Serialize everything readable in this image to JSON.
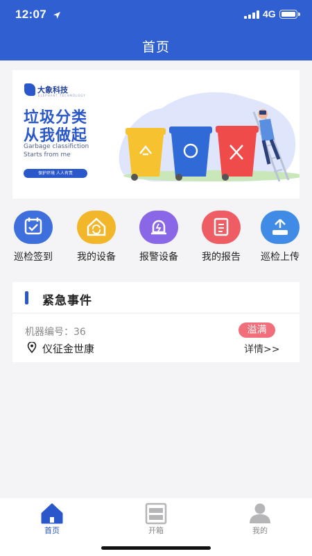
{
  "status_bar": {
    "time": "12:07",
    "network": "4G"
  },
  "header": {
    "title": "首页"
  },
  "banner": {
    "logo_text": "大象科技",
    "logo_sub": "ELEPHANT TECHNOLOGY",
    "headline_1": "垃圾分类",
    "headline_2": "从我做起",
    "english_1": "Garbage classifiction",
    "english_2": "Starts from me",
    "pill": "保护环境 人人有责"
  },
  "quick_actions": [
    {
      "label": "巡检签到",
      "icon": "calendar-check-icon",
      "color": "#3f6fdc"
    },
    {
      "label": "我的设备",
      "icon": "device-home-icon",
      "color": "#f2b62b"
    },
    {
      "label": "报警设备",
      "icon": "alarm-bell-icon",
      "color": "#8a67e6"
    },
    {
      "label": "我的报告",
      "icon": "report-document-icon",
      "color": "#ee5d64"
    },
    {
      "label": "巡检上传",
      "icon": "upload-tray-icon",
      "color": "#3f8be6"
    }
  ],
  "emergency": {
    "title": "紧急事件",
    "machine": "机器编号：36",
    "status": "溢满",
    "location": "仪征金世康",
    "detail_link": "详情>>"
  },
  "tabs": [
    {
      "label": "首页",
      "icon": "home-icon",
      "active": true
    },
    {
      "label": "开箱",
      "icon": "open-box-icon",
      "active": false
    },
    {
      "label": "我的",
      "icon": "profile-icon",
      "active": false
    }
  ],
  "colors": {
    "primary": "#2f5fd0",
    "badge": "#f06f7a",
    "tab_active": "#2a57c9",
    "tab_inactive": "#b5b5b8"
  }
}
